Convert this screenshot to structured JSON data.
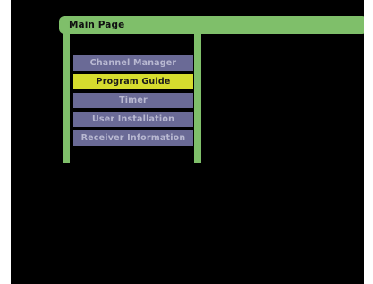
{
  "header": {
    "title": "Main Page"
  },
  "menu": {
    "items": [
      {
        "label": "Channel Manager",
        "selected": false
      },
      {
        "label": "Program Guide",
        "selected": true
      },
      {
        "label": "Timer",
        "selected": false
      },
      {
        "label": "User Installation",
        "selected": false
      },
      {
        "label": "Receiver Information",
        "selected": false
      }
    ]
  },
  "colors": {
    "frame": "#7fbf6a",
    "menu_item": "#6a6a96",
    "menu_item_selected": "#d6dc2e",
    "background": "#000000"
  }
}
